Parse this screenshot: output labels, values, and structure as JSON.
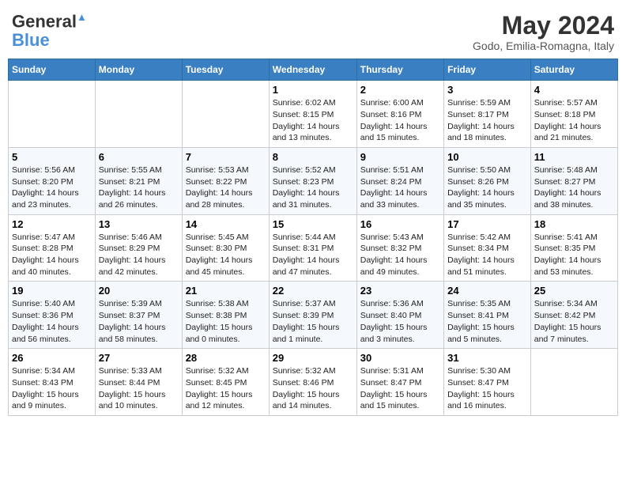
{
  "header": {
    "logo_line1": "General",
    "logo_line2": "Blue",
    "month_title": "May 2024",
    "location": "Godo, Emilia-Romagna, Italy"
  },
  "days_of_week": [
    "Sunday",
    "Monday",
    "Tuesday",
    "Wednesday",
    "Thursday",
    "Friday",
    "Saturday"
  ],
  "weeks": [
    [
      {
        "day": "",
        "info": ""
      },
      {
        "day": "",
        "info": ""
      },
      {
        "day": "",
        "info": ""
      },
      {
        "day": "1",
        "info": "Sunrise: 6:02 AM\nSunset: 8:15 PM\nDaylight: 14 hours\nand 13 minutes."
      },
      {
        "day": "2",
        "info": "Sunrise: 6:00 AM\nSunset: 8:16 PM\nDaylight: 14 hours\nand 15 minutes."
      },
      {
        "day": "3",
        "info": "Sunrise: 5:59 AM\nSunset: 8:17 PM\nDaylight: 14 hours\nand 18 minutes."
      },
      {
        "day": "4",
        "info": "Sunrise: 5:57 AM\nSunset: 8:18 PM\nDaylight: 14 hours\nand 21 minutes."
      }
    ],
    [
      {
        "day": "5",
        "info": "Sunrise: 5:56 AM\nSunset: 8:20 PM\nDaylight: 14 hours\nand 23 minutes."
      },
      {
        "day": "6",
        "info": "Sunrise: 5:55 AM\nSunset: 8:21 PM\nDaylight: 14 hours\nand 26 minutes."
      },
      {
        "day": "7",
        "info": "Sunrise: 5:53 AM\nSunset: 8:22 PM\nDaylight: 14 hours\nand 28 minutes."
      },
      {
        "day": "8",
        "info": "Sunrise: 5:52 AM\nSunset: 8:23 PM\nDaylight: 14 hours\nand 31 minutes."
      },
      {
        "day": "9",
        "info": "Sunrise: 5:51 AM\nSunset: 8:24 PM\nDaylight: 14 hours\nand 33 minutes."
      },
      {
        "day": "10",
        "info": "Sunrise: 5:50 AM\nSunset: 8:26 PM\nDaylight: 14 hours\nand 35 minutes."
      },
      {
        "day": "11",
        "info": "Sunrise: 5:48 AM\nSunset: 8:27 PM\nDaylight: 14 hours\nand 38 minutes."
      }
    ],
    [
      {
        "day": "12",
        "info": "Sunrise: 5:47 AM\nSunset: 8:28 PM\nDaylight: 14 hours\nand 40 minutes."
      },
      {
        "day": "13",
        "info": "Sunrise: 5:46 AM\nSunset: 8:29 PM\nDaylight: 14 hours\nand 42 minutes."
      },
      {
        "day": "14",
        "info": "Sunrise: 5:45 AM\nSunset: 8:30 PM\nDaylight: 14 hours\nand 45 minutes."
      },
      {
        "day": "15",
        "info": "Sunrise: 5:44 AM\nSunset: 8:31 PM\nDaylight: 14 hours\nand 47 minutes."
      },
      {
        "day": "16",
        "info": "Sunrise: 5:43 AM\nSunset: 8:32 PM\nDaylight: 14 hours\nand 49 minutes."
      },
      {
        "day": "17",
        "info": "Sunrise: 5:42 AM\nSunset: 8:34 PM\nDaylight: 14 hours\nand 51 minutes."
      },
      {
        "day": "18",
        "info": "Sunrise: 5:41 AM\nSunset: 8:35 PM\nDaylight: 14 hours\nand 53 minutes."
      }
    ],
    [
      {
        "day": "19",
        "info": "Sunrise: 5:40 AM\nSunset: 8:36 PM\nDaylight: 14 hours\nand 56 minutes."
      },
      {
        "day": "20",
        "info": "Sunrise: 5:39 AM\nSunset: 8:37 PM\nDaylight: 14 hours\nand 58 minutes."
      },
      {
        "day": "21",
        "info": "Sunrise: 5:38 AM\nSunset: 8:38 PM\nDaylight: 15 hours\nand 0 minutes."
      },
      {
        "day": "22",
        "info": "Sunrise: 5:37 AM\nSunset: 8:39 PM\nDaylight: 15 hours\nand 1 minute."
      },
      {
        "day": "23",
        "info": "Sunrise: 5:36 AM\nSunset: 8:40 PM\nDaylight: 15 hours\nand 3 minutes."
      },
      {
        "day": "24",
        "info": "Sunrise: 5:35 AM\nSunset: 8:41 PM\nDaylight: 15 hours\nand 5 minutes."
      },
      {
        "day": "25",
        "info": "Sunrise: 5:34 AM\nSunset: 8:42 PM\nDaylight: 15 hours\nand 7 minutes."
      }
    ],
    [
      {
        "day": "26",
        "info": "Sunrise: 5:34 AM\nSunset: 8:43 PM\nDaylight: 15 hours\nand 9 minutes."
      },
      {
        "day": "27",
        "info": "Sunrise: 5:33 AM\nSunset: 8:44 PM\nDaylight: 15 hours\nand 10 minutes."
      },
      {
        "day": "28",
        "info": "Sunrise: 5:32 AM\nSunset: 8:45 PM\nDaylight: 15 hours\nand 12 minutes."
      },
      {
        "day": "29",
        "info": "Sunrise: 5:32 AM\nSunset: 8:46 PM\nDaylight: 15 hours\nand 14 minutes."
      },
      {
        "day": "30",
        "info": "Sunrise: 5:31 AM\nSunset: 8:47 PM\nDaylight: 15 hours\nand 15 minutes."
      },
      {
        "day": "31",
        "info": "Sunrise: 5:30 AM\nSunset: 8:47 PM\nDaylight: 15 hours\nand 16 minutes."
      },
      {
        "day": "",
        "info": ""
      }
    ]
  ]
}
